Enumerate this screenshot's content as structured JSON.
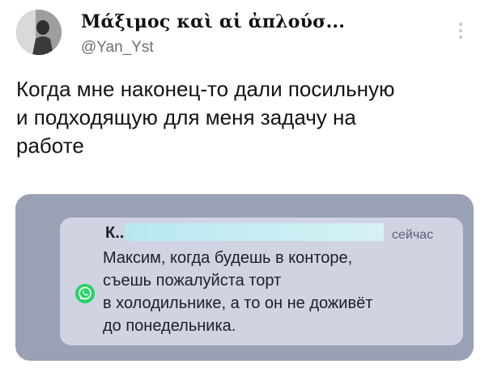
{
  "author": {
    "name": "Μάξιμος καὶ αἱ ἀπλούσ...",
    "handle": "@Yan_Yst"
  },
  "tweet": {
    "text": "Когда мне наконец-то дали посильную\nи подходящую для меня задачу на\nработе"
  },
  "notification": {
    "sender": "К...",
    "time": "сейчас",
    "body": "Максим, когда будешь в конторе,\nсъешь пожалуйста торт\nв холодильнике, а то он не доживёт\nдо понедельника.",
    "app_icon": "whatsapp-icon"
  },
  "colors": {
    "accent": "#25d366",
    "outer_banner": "#9aa1b5",
    "inner_banner": "#cfd3e2",
    "redaction": "#c9eef3"
  }
}
